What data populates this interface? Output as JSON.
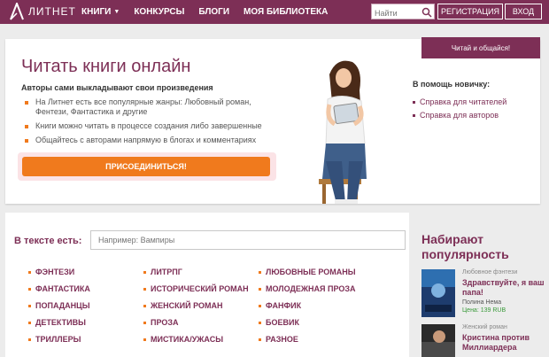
{
  "header": {
    "logo_text": "ЛИТНЕТ",
    "nav": [
      {
        "label": "КНИГИ",
        "has_caret": true
      },
      {
        "label": "КОНКУРСЫ"
      },
      {
        "label": "БЛОГИ"
      },
      {
        "label": "МОЯ БИБЛИОТЕКА"
      }
    ],
    "search_placeholder": "Найти",
    "register_label": "РЕГИСТРАЦИЯ",
    "login_label": "ВХОД"
  },
  "hero": {
    "title": "Читать книги онлайн",
    "subtitle": "Авторы сами выкладывают свои произведения",
    "bullets": [
      "На Литнет есть все популярные жанры: Любовный роман, Фентези, Фантастика и другие",
      "Книги можно читать в процессе создания либо завершенные",
      "Общайтесь с авторами напрямую в блогах и комментариях"
    ],
    "join_label": "ПРИСОЕДИНИТЬСЯ!"
  },
  "chat_tab": "Читай и общайся!",
  "help": {
    "title": "В помощь новичку:",
    "links": [
      "Справка для читателей",
      "Справка для авторов"
    ]
  },
  "genres": {
    "label": "В тексте есть:",
    "placeholder": "Например: Вампиры",
    "columns": [
      [
        "ФЭНТЕЗИ",
        "ФАНТАСТИКА",
        "ПОПАДАНЦЫ",
        "ДЕТЕКТИВЫ",
        "ТРИЛЛЕРЫ"
      ],
      [
        "ЛИТРПГ",
        "ИСТОРИЧЕСКИЙ РОМАН",
        "ЖЕНСКИЙ РОМАН",
        "ПРОЗА",
        "МИСТИКА/УЖАСЫ"
      ],
      [
        "ЛЮБОВНЫЕ РОМАНЫ",
        "МОЛОДЕЖНАЯ ПРОЗА",
        "ФАНФИК",
        "БОЕВИК",
        "РАЗНОЕ"
      ]
    ]
  },
  "popular": {
    "title": "Набирают популярность",
    "books": [
      {
        "genre": "Любовное фэнтези",
        "title": "Здравствуйте, я ваш папа!",
        "author": "Полина Нема",
        "price": "Цена: 139 RUB"
      },
      {
        "genre": "Женский роман",
        "title": "Кристина против Миллиардера",
        "author": "",
        "price": ""
      }
    ]
  },
  "colors": {
    "brand": "#7d2f56",
    "accent": "#f07a1d"
  }
}
